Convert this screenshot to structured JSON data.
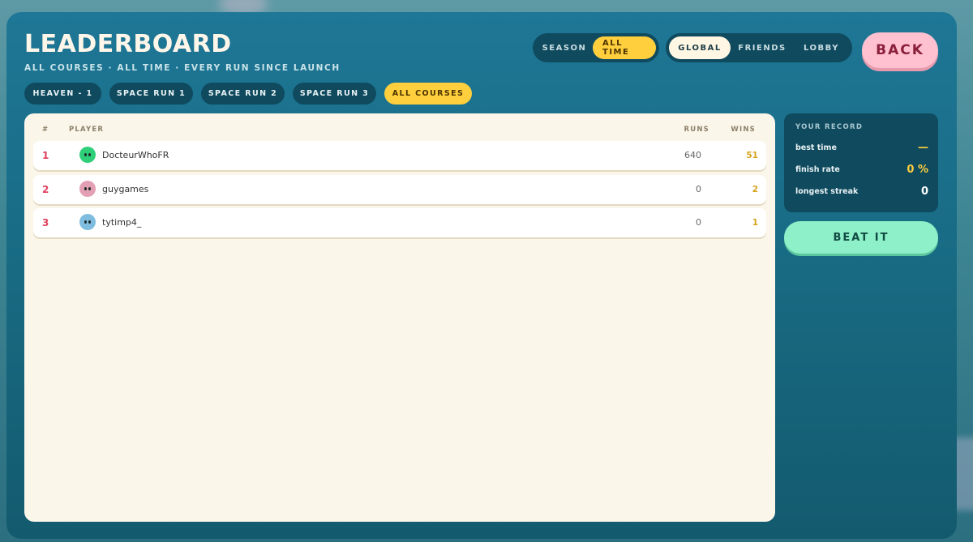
{
  "header": {
    "title": "LEADERBOARD",
    "subtitle": "ALL COURSES · ALL TIME · EVERY RUN SINCE LAUNCH"
  },
  "time_filter": {
    "season": "SEASON",
    "all_time": "ALL TIME",
    "selected": "ALL TIME"
  },
  "scope_filter": {
    "global": "GLOBAL",
    "friends": "FRIENDS",
    "lobby": "LOBBY",
    "selected": "GLOBAL"
  },
  "back_label": "BACK",
  "courses": [
    {
      "label": "HEAVEN - 1",
      "active": false
    },
    {
      "label": "SPACE RUN 1",
      "active": false
    },
    {
      "label": "SPACE RUN 2",
      "active": false
    },
    {
      "label": "SPACE RUN 3",
      "active": false
    },
    {
      "label": "ALL COURSES",
      "active": true
    }
  ],
  "table": {
    "columns": {
      "rank": "#",
      "player": "PLAYER",
      "runs": "RUNS",
      "wins": "WINS"
    },
    "rows": [
      {
        "rank": "1",
        "player": "DocteurWhoFR",
        "runs": "640",
        "wins": "51",
        "avatar_color": "#2fcf7a"
      },
      {
        "rank": "2",
        "player": "guygames",
        "runs": "0",
        "wins": "2",
        "avatar_color": "#e3a0b4"
      },
      {
        "rank": "3",
        "player": "tytimp4_",
        "runs": "0",
        "wins": "1",
        "avatar_color": "#7fbde0"
      }
    ]
  },
  "record": {
    "title": "YOUR RECORD",
    "best_time_label": "best time",
    "best_time_value": "—",
    "finish_rate_label": "finish rate",
    "finish_rate_value": "0 %",
    "longest_streak_label": "longest streak",
    "longest_streak_value": "0"
  },
  "beat_label": "BEAT IT",
  "colors": {
    "accent_yellow": "#ffcf3d",
    "rank_red": "#e0415f",
    "wins_gold": "#d4a21a",
    "back_pink": "#ffc1cf",
    "beat_mint": "#8ef0c8"
  }
}
